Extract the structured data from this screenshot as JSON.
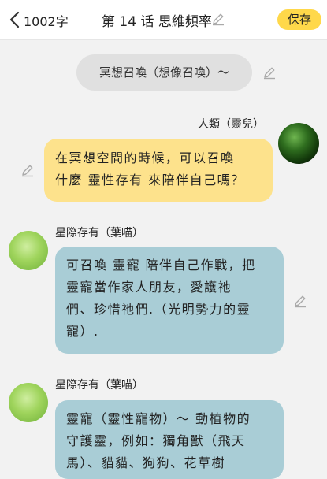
{
  "header": {
    "word_count": "1002字",
    "title": "第 14 话 思維頻率",
    "save_label": "保存",
    "colors": {
      "save_button": "#ffd84a"
    }
  },
  "chat": {
    "scene_note": "冥想召喚（想像召喚）～",
    "messages": [
      {
        "speaker": "人類（靈兒）",
        "side": "right",
        "bubble_color": "#fde28c",
        "lines": [
          "在冥想空間的時候，可以召喚",
          "什麼 靈性存有 來陪伴自己嗎？"
        ]
      },
      {
        "speaker": "星際存有（葉喵）",
        "side": "left",
        "bubble_color": "#a9cdd6",
        "lines": [
          "可召喚 靈寵 陪伴自己作戰，把",
          "靈寵當作家人朋友，愛護祂",
          "們、珍惜祂們.（光明勢力的靈",
          "寵）."
        ]
      },
      {
        "speaker": "星際存有（葉喵）",
        "side": "left",
        "bubble_color": "#a9cdd6",
        "lines": [
          "靈寵（靈性寵物）～ 動植物的",
          "守護靈，例如：獨角獸（飛天",
          "馬）、貓貓、狗狗、花草樹"
        ]
      }
    ]
  },
  "icons": {
    "back": "chevron-left-icon",
    "edit": "pencil-icon"
  }
}
